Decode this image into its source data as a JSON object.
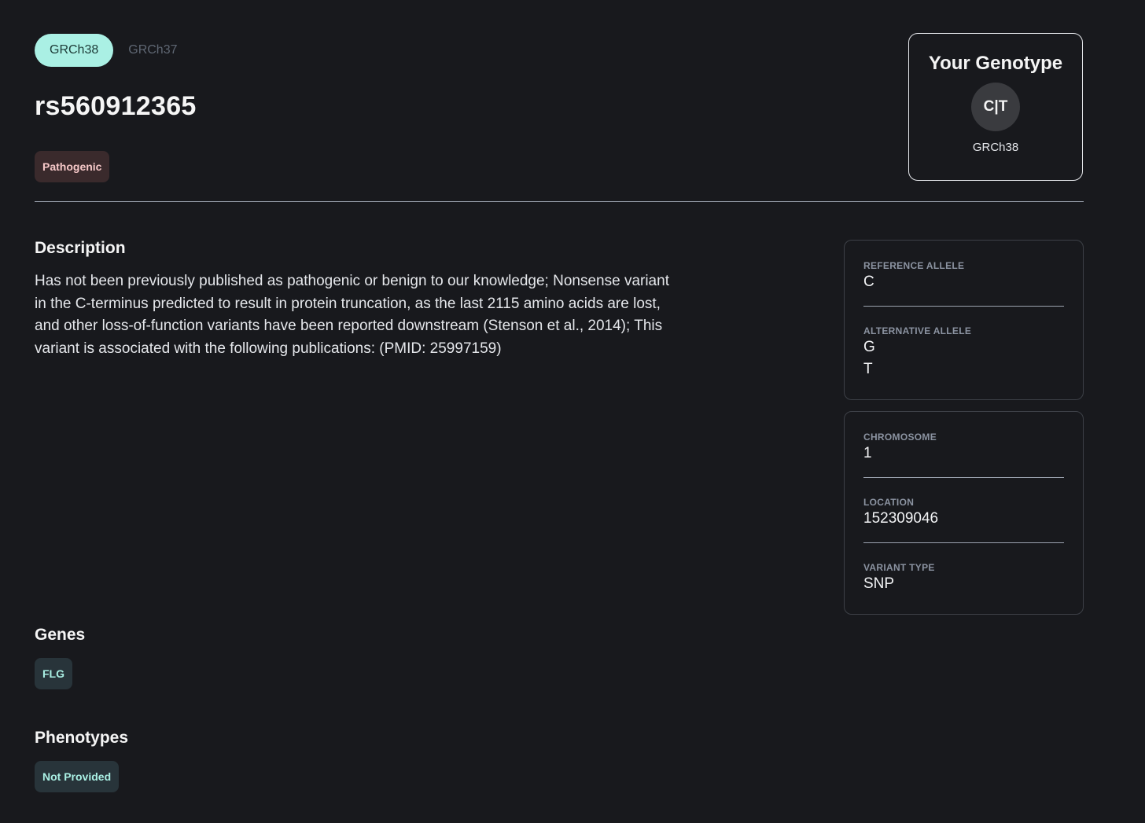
{
  "assembly_tabs": [
    {
      "label": "GRCh38",
      "active": true
    },
    {
      "label": "GRCh37",
      "active": false
    }
  ],
  "variant": {
    "rsid": "rs560912365",
    "significance": "Pathogenic"
  },
  "genotype_card": {
    "title": "Your Genotype",
    "genotype": "C|T",
    "assembly": "GRCh38"
  },
  "description": {
    "title": "Description",
    "text": "Has not been previously published as pathogenic or benign to our knowledge; Nonsense variant in the C-terminus predicted to result in protein truncation, as the last 2115 amino acids are lost, and other loss-of-function variants have been reported downstream (Stenson et al., 2014); This variant is associated with the following publications: (PMID: 25997159)"
  },
  "alleles": {
    "reference_label": "REFERENCE ALLELE",
    "reference_value": "C",
    "alternative_label": "ALTERNATIVE ALLELE",
    "alternative_values": [
      "G",
      "T"
    ]
  },
  "location_info": {
    "chromosome_label": "CHROMOSOME",
    "chromosome_value": "1",
    "location_label": "LOCATION",
    "location_value": "152309046",
    "variant_type_label": "VARIANT TYPE",
    "variant_type_value": "SNP"
  },
  "genes": {
    "title": "Genes",
    "items": [
      "FLG"
    ]
  },
  "phenotypes": {
    "title": "Phenotypes",
    "items": [
      "Not Provided"
    ]
  },
  "colors": {
    "background": "#18191d",
    "accent": "#aaf0e4",
    "pathogenic_bg": "#3a2a2c",
    "pathogenic_text": "#f6c8c8"
  }
}
